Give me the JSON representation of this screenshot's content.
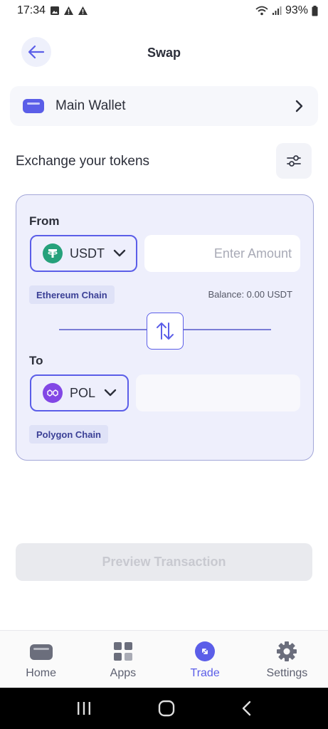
{
  "status": {
    "time": "17:34",
    "battery": "93%"
  },
  "header": {
    "title": "Swap"
  },
  "wallet": {
    "label": "Main Wallet"
  },
  "exchange": {
    "title": "Exchange your tokens"
  },
  "from": {
    "label": "From",
    "token": "USDT",
    "amount_placeholder": "Enter Amount",
    "chain": "Ethereum Chain",
    "balance": "Balance: 0.00 USDT"
  },
  "to": {
    "label": "To",
    "token": "POL",
    "chain": "Polygon Chain"
  },
  "actions": {
    "preview_label": "Preview Transaction"
  },
  "nav": {
    "items": [
      {
        "label": "Home",
        "icon": "wallet-icon"
      },
      {
        "label": "Apps",
        "icon": "apps-grid-icon"
      },
      {
        "label": "Trade",
        "icon": "trade-icon",
        "active": true
      },
      {
        "label": "Settings",
        "icon": "gear-icon"
      }
    ]
  },
  "colors": {
    "accent": "#5b5ee8",
    "tether": "#26a17b",
    "polygon": "#8247e5",
    "card_bg": "#eeeffc"
  }
}
